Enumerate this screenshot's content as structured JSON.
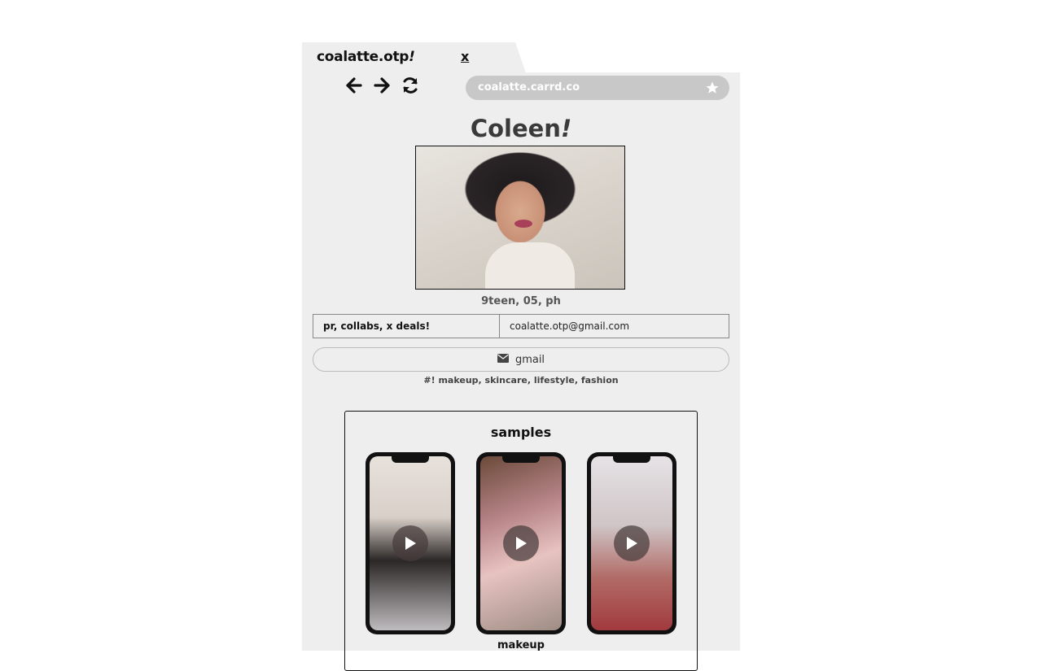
{
  "tab": {
    "title": "coalatte.otp",
    "title_suffix": "!",
    "close_label": "x"
  },
  "nav": {
    "back_icon": "arrow-left-icon",
    "forward_icon": "arrow-right-icon",
    "refresh_icon": "refresh-icon"
  },
  "urlbar": {
    "url": "coalatte.carrd.co",
    "icon": "star-icon"
  },
  "profile": {
    "name": "Coleen",
    "name_suffix": "!",
    "subtitle": "9teen, 05, ph"
  },
  "contact_table": {
    "label": "pr, collabs, x deals!",
    "email": "coalatte.otp@gmail.com"
  },
  "gmail_button": {
    "label": "gmail",
    "icon": "envelope-icon"
  },
  "tags": "#! makeup, skincare, lifestyle, fashion",
  "samples": {
    "title": "samples",
    "items": [
      {
        "label": ""
      },
      {
        "label": "makeup"
      },
      {
        "label": ""
      }
    ]
  }
}
